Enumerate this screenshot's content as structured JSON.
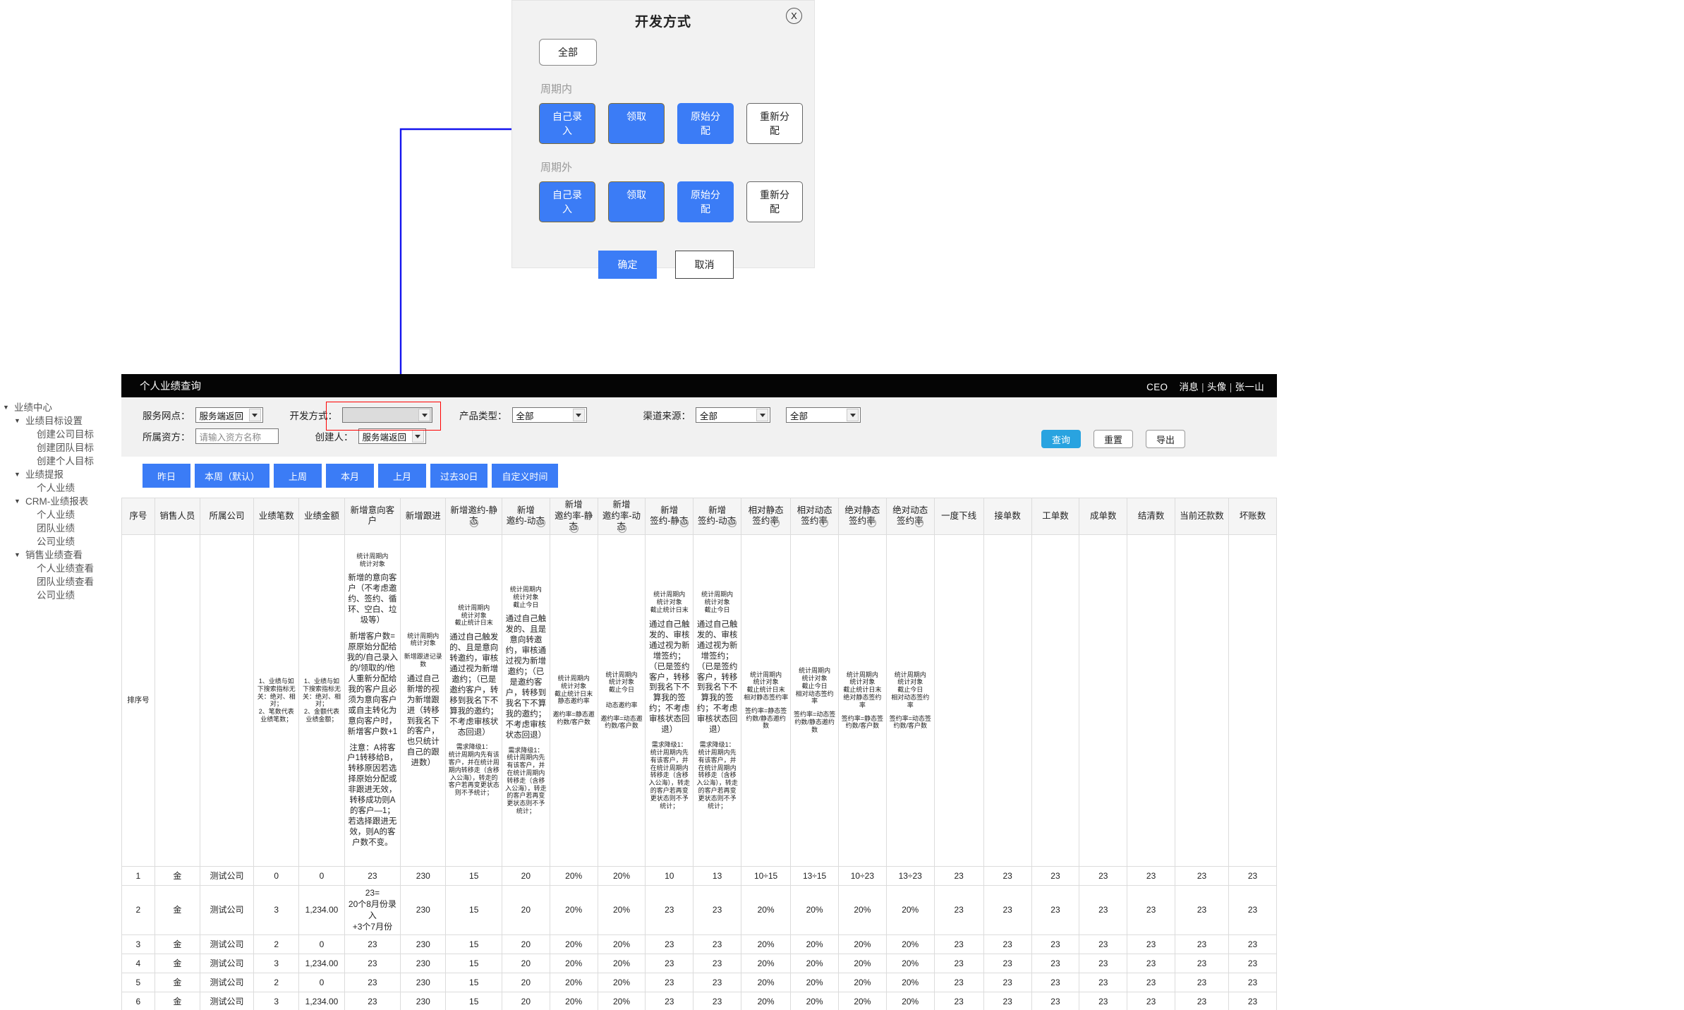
{
  "modal": {
    "title": "开发方式",
    "close_label": "X",
    "all_button": "全部",
    "groups": [
      {
        "label": "周期内",
        "buttons": [
          {
            "text": "自己录入",
            "style": "primary-ring"
          },
          {
            "text": "领取",
            "style": "primary-ring"
          },
          {
            "text": "原始分配",
            "style": "primary"
          },
          {
            "text": "重新分配",
            "style": "ghost"
          }
        ]
      },
      {
        "label": "周期外",
        "buttons": [
          {
            "text": "自己录入",
            "style": "primary-ring"
          },
          {
            "text": "领取",
            "style": "primary-ring"
          },
          {
            "text": "原始分配",
            "style": "primary"
          },
          {
            "text": "重新分配",
            "style": "ghost"
          }
        ]
      }
    ],
    "confirm": "确定",
    "cancel": "取消"
  },
  "sidebar": {
    "items": [
      {
        "label": "业绩中心",
        "level": 0,
        "caret": true
      },
      {
        "label": "业绩目标设置",
        "level": 1,
        "caret": true
      },
      {
        "label": "创建公司目标",
        "level": 2,
        "caret": false
      },
      {
        "label": "创建团队目标",
        "level": 2,
        "caret": false
      },
      {
        "label": "创建个人目标",
        "level": 2,
        "caret": false
      },
      {
        "label": "业绩提报",
        "level": 1,
        "caret": true
      },
      {
        "label": "个人业绩",
        "level": 2,
        "caret": false
      },
      {
        "label": "CRM-业绩报表",
        "level": 1,
        "caret": true
      },
      {
        "label": "个人业绩",
        "level": 2,
        "caret": false
      },
      {
        "label": "团队业绩",
        "level": 2,
        "caret": false
      },
      {
        "label": "公司业绩",
        "level": 2,
        "caret": false
      },
      {
        "label": "销售业绩查看",
        "level": 1,
        "caret": true
      },
      {
        "label": "个人业绩查看",
        "level": 2,
        "caret": false
      },
      {
        "label": "团队业绩查看",
        "level": 2,
        "caret": false
      },
      {
        "label": "公司业绩",
        "level": 2,
        "caret": false
      }
    ]
  },
  "titlebar": {
    "title": "个人业绩查询",
    "role": "CEO",
    "messages": "消息",
    "avatar": "头像",
    "username": "张一山",
    "sep": "|"
  },
  "filters": {
    "service_point_label": "服务网点：",
    "service_point_value": "服务端返回",
    "dev_mode_label": "开发方式：",
    "dev_mode_value": "",
    "product_type_label": "产品类型：",
    "product_type_value": "全部",
    "channel_label": "渠道来源：",
    "channel_value": "全部",
    "channel_sub_value": "全部",
    "funder_label": "所属资方：",
    "funder_placeholder": "请输入资方名称",
    "creator_label": "创建人：",
    "creator_value": "服务端返回",
    "query": "查询",
    "reset": "重置",
    "export": "导出"
  },
  "date_tabs": [
    "昨日",
    "本周（默认）",
    "上周",
    "本月",
    "上月",
    "过去30日",
    "自定义时间"
  ],
  "table": {
    "columns": [
      {
        "label": "序号",
        "info": false
      },
      {
        "label": "销售人员",
        "info": false
      },
      {
        "label": "所属公司",
        "info": false
      },
      {
        "label": "业绩笔数",
        "info": false
      },
      {
        "label": "业绩金额",
        "info": false
      },
      {
        "label": "新增意向客户",
        "info": false
      },
      {
        "label": "新增跟进",
        "info": false
      },
      {
        "label": "新增邀约-静态",
        "info": true,
        "lines": [
          "新增邀约-静态"
        ]
      },
      {
        "label": "新增邀约-动态",
        "info": true,
        "lines": [
          "新增",
          "邀约-动态"
        ]
      },
      {
        "label": "新增邀约率-静态",
        "info": true,
        "lines": [
          "新增",
          "邀约率-静态"
        ]
      },
      {
        "label": "新增邀约率-动态",
        "info": true,
        "lines": [
          "新增",
          "邀约率-动态"
        ]
      },
      {
        "label": "新增签约-静态",
        "info": true,
        "lines": [
          "新增",
          "签约-静态"
        ]
      },
      {
        "label": "新增签约-动态",
        "info": true,
        "lines": [
          "新增",
          "签约-动态"
        ]
      },
      {
        "label": "相对静态签约率",
        "info": true,
        "lines": [
          "相对静态",
          "签约率"
        ]
      },
      {
        "label": "相对动态签约率",
        "info": true,
        "lines": [
          "相对动态",
          "签约率"
        ]
      },
      {
        "label": "绝对静态签约率",
        "info": true,
        "lines": [
          "绝对静态",
          "签约率"
        ]
      },
      {
        "label": "绝对动态签约率",
        "info": true,
        "lines": [
          "绝对动态",
          "签约率"
        ]
      },
      {
        "label": "一度下线",
        "info": false
      },
      {
        "label": "接单数",
        "info": false
      },
      {
        "label": "工单数",
        "info": false
      },
      {
        "label": "成单数",
        "info": false
      },
      {
        "label": "结清数",
        "info": false
      },
      {
        "label": "当前还款数",
        "info": false
      },
      {
        "label": "坏账数",
        "info": false
      }
    ],
    "desc_row": {
      "c0": "排序号",
      "c1": "",
      "c2": "",
      "c3": "1、业绩与如下搜索指标无关：绝对、相对；\n2、笔数代表业绩笔数；",
      "c4": "1、业绩与如下搜索指标无关：绝对、相对；\n2、金额代表业绩金额；",
      "c5_p1": "统计周期内\n统计对象",
      "c5_p2": "新增的意向客户（不考虑邀约、签约、循环、空白、垃圾等）",
      "c5_p3": "新增客户数=原原始分配给我的/自己录入的/领取的/他人重新分配给我的客户且必须为意向客户或自主转化为意向客户时，新增客户数+1",
      "c5_p4": "注意：A将客户1转移给B，转移原因若选择原始分配或非跟进无效，转移成功则A的客户—1；若选择跟进无效，则A的客户数不变。",
      "c6_p1": "统计周期内\n统计对象",
      "c6_p2": "新增跟进记录数",
      "c6_p3": "通过自己新增的视为新增跟进（转移到我名下的客户，也只统计自己的跟进数）",
      "c7_p1": "统计周期内\n统计对象\n截止统计日末",
      "c7_p2": "通过自己触发的、且是意向转邀约，审核通过视为新增邀约；（已是邀约客户，转移到我名下不算我的邀约；不考虑审核状态回退）",
      "c7_p3": "需求降级1：\n统计周期内先有该客户，并在统计周期内转移走（含移入公海），转走的客户若再变更状态则不予统计；",
      "c8_p1": "统计周期内\n统计对象\n截止今日",
      "c8_p2": "通过自己触发的、且是意向转邀约，审核通过视为新增邀约；（已是邀约客户，转移到我名下不算我的邀约；不考虑审核状态回退）",
      "c8_p3": "需求降级1：\n统计周期内先有该客户，并在统计周期内转移走（含移入公海），转走的客户若再变更状态则不予统计；",
      "c9_p1": "统计周期内\n统计对象\n截止统计日末\n静态邀约率",
      "c9_p2": "邀约率=静态邀约数/客户数",
      "c10_p1": "统计周期内\n统计对象\n截止今日\n\n动态邀约率",
      "c10_p2": "邀约率=动态邀约数/客户数",
      "c11_p1": "统计周期内\n统计对象\n截止统计日末",
      "c11_p2": "通过自己触发的、审核通过视为新增签约；（已是签约客户，转移到我名下不算我的签约；不考虑审核状态回退）",
      "c11_p3": "需求降级1：\n统计周期内先有该客户，并在统计周期内转移走（含移入公海），转走的客户若再变更状态则不予统计；",
      "c12_p1": "统计周期内\n统计对象\n截止今日",
      "c12_p2": "通过自己触发的、审核通过视为新增签约；（已是签约客户，转移到我名下不算我的签约；不考虑审核状态回退）",
      "c12_p3": "需求降级1：\n统计周期内先有该客户，并在统计周期内转移走（含移入公海），转走的客户若再变更状态则不予统计；",
      "c13_p1": "统计周期内\n统计对象\n截止统计日末\n相对静态签约率",
      "c13_p2": "签约率=静态签约数/静态邀约数",
      "c14_p1": "统计周期内\n统计对象\n截止今日\n相对动态签约率",
      "c14_p2": "签约率=动态签约数/静态邀约数",
      "c15_p1": "统计周期内\n统计对象\n截止统计日末\n绝对静态签约率",
      "c15_p2": "签约率=静态签约数/客户数",
      "c16_p1": "统计周期内\n统计对象\n截止今日\n相对动态签约率",
      "c16_p2": "签约率=动态签约数/客户数"
    },
    "rows": [
      {
        "tall": false,
        "cells": [
          "1",
          "金",
          "测试公司",
          "0",
          "0",
          "23",
          "230",
          "15",
          "20",
          "20%",
          "20%",
          "10",
          "13",
          "10÷15",
          "13÷15",
          "10÷23",
          "13÷23",
          "23",
          "23",
          "23",
          "23",
          "23",
          "23",
          "23"
        ]
      },
      {
        "tall": true,
        "cells": [
          "2",
          "金",
          "测试公司",
          "3",
          "1,234.00",
          "23=\n20个8月份录入\n+3个7月份",
          "230",
          "15",
          "20",
          "20%",
          "20%",
          "23",
          "23",
          "20%",
          "20%",
          "20%",
          "20%",
          "23",
          "23",
          "23",
          "23",
          "23",
          "23",
          "23"
        ]
      },
      {
        "tall": false,
        "cells": [
          "3",
          "金",
          "测试公司",
          "2",
          "0",
          "23",
          "230",
          "15",
          "20",
          "20%",
          "20%",
          "23",
          "23",
          "20%",
          "20%",
          "20%",
          "20%",
          "23",
          "23",
          "23",
          "23",
          "23",
          "23",
          "23"
        ]
      },
      {
        "tall": false,
        "cells": [
          "4",
          "金",
          "测试公司",
          "3",
          "1,234.00",
          "23",
          "230",
          "15",
          "20",
          "20%",
          "20%",
          "23",
          "23",
          "20%",
          "20%",
          "20%",
          "20%",
          "23",
          "23",
          "23",
          "23",
          "23",
          "23",
          "23"
        ]
      },
      {
        "tall": false,
        "cells": [
          "5",
          "金",
          "测试公司",
          "2",
          "0",
          "23",
          "230",
          "15",
          "20",
          "20%",
          "20%",
          "23",
          "23",
          "20%",
          "20%",
          "20%",
          "20%",
          "23",
          "23",
          "23",
          "23",
          "23",
          "23",
          "23"
        ]
      },
      {
        "tall": false,
        "cells": [
          "6",
          "金",
          "测试公司",
          "3",
          "1,234.00",
          "23",
          "230",
          "15",
          "20",
          "20%",
          "20%",
          "23",
          "23",
          "20%",
          "20%",
          "20%",
          "20%",
          "23",
          "23",
          "23",
          "23",
          "23",
          "23",
          "23"
        ]
      }
    ]
  },
  "colors": {
    "primary_blue": "#3b7cf6",
    "query_blue": "#29a3e0",
    "titlebar_black": "#050505",
    "highlight_red": "#ff0000",
    "connector_blue": "#1414ee"
  }
}
